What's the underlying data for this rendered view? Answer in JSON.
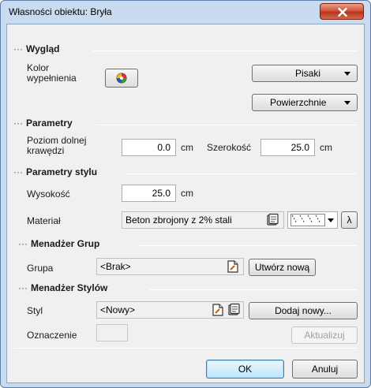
{
  "window": {
    "title": "Własności obiektu: Bryła"
  },
  "icons": {
    "close": "close-icon",
    "color_wheel": "color-wheel-icon",
    "edit": "edit-document-icon",
    "library": "material-library-icon",
    "hatch": "hatch-pattern-icon",
    "lambda": "lambda-icon"
  },
  "sections": {
    "wyglad": {
      "header": "Wygląd",
      "fill_color_label": "Kolor wypełnienia",
      "pens_label": "Pisaki",
      "surfaces_label": "Powierzchnie"
    },
    "parametry": {
      "header": "Parametry",
      "bottom_edge_label": "Poziom dolnej krawędzi",
      "bottom_edge_value": "0.0",
      "bottom_edge_unit": "cm",
      "width_label": "Szerokość",
      "width_value": "25.0",
      "width_unit": "cm"
    },
    "parametry_stylu": {
      "header": "Parametry stylu",
      "height_label": "Wysokość",
      "height_value": "25.0",
      "height_unit": "cm",
      "material_label": "Materiał",
      "material_value": "Beton zbrojony z 2% stali",
      "lambda_label": "λ"
    },
    "menadzer_grup": {
      "header": "Menadżer Grup",
      "group_label": "Grupa",
      "group_value": "<Brak>",
      "create_new_label": "Utwórz nową"
    },
    "menadzer_stylow": {
      "header": "Menadżer Stylów",
      "style_label": "Styl",
      "style_value": "<Nowy>",
      "add_new_label": "Dodaj nowy...",
      "marking_label": "Oznaczenie",
      "marking_value": "",
      "update_label": "Aktualizuj"
    }
  },
  "footer": {
    "ok_label": "OK",
    "cancel_label": "Anuluj"
  }
}
